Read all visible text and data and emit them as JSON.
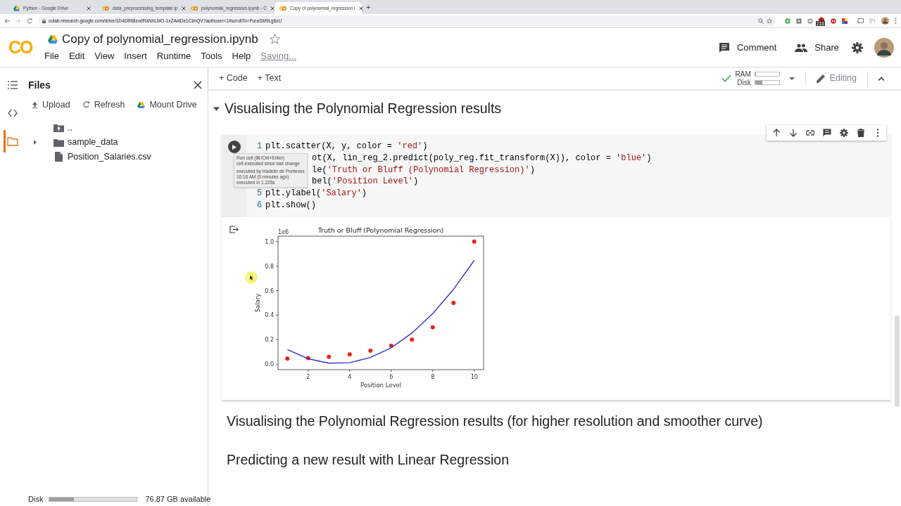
{
  "browser": {
    "tabs": [
      {
        "title": "Python - Google Drive",
        "selected": false
      },
      {
        "title": "data_preprocessing_template.ip",
        "selected": false
      },
      {
        "title": "polynomial_regression.ipynb - C",
        "selected": false
      },
      {
        "title": "Copy of polynomial_regression.i",
        "selected": true
      }
    ],
    "new_tab": "+",
    "url": "colab.research.google.com/drive/1D4DRl8izvdRaNhLMO-1xZAi4De1CimQV?authuser=1#scrollTo=PuraSM9Lg6zU",
    "extension_badge": "216"
  },
  "app": {
    "logo": "CO",
    "title": "Copy of polynomial_regression.ipynb",
    "starred": false,
    "menu": [
      "File",
      "Edit",
      "View",
      "Insert",
      "Runtime",
      "Tools",
      "Help"
    ],
    "save_status": "Saving...",
    "actions": [
      {
        "label": "Comment",
        "kind": "comment"
      },
      {
        "label": "Share",
        "kind": "share"
      }
    ]
  },
  "toolbar": {
    "insert": [
      "+ Code",
      "+ Text"
    ],
    "connected": true,
    "meters": [
      {
        "label": "RAM",
        "level": 0.04
      },
      {
        "label": "Disk",
        "level": 0.3
      }
    ],
    "mode": "Editing"
  },
  "sidebar": {
    "tabs": [
      {
        "kind": "toc",
        "selected": false
      },
      {
        "kind": "code",
        "selected": false
      },
      {
        "kind": "files",
        "selected": true
      }
    ],
    "title": "Files",
    "actions": [
      {
        "label": "Upload",
        "kind": "upload"
      },
      {
        "label": "Refresh",
        "kind": "refresh"
      },
      {
        "label": "Mount Drive",
        "kind": "drive"
      }
    ],
    "files": [
      {
        "name": "..",
        "kind": "parent"
      },
      {
        "name": "sample_data",
        "kind": "folder",
        "expanded": false
      },
      {
        "name": "Position_Salaries.csv",
        "kind": "file"
      }
    ],
    "disk": {
      "label": "Disk",
      "level": 0.28,
      "available": "76.87 GB available"
    }
  },
  "notebook": {
    "cells": [
      {
        "kind": "section",
        "text": "Visualising the Polynomial Regression results",
        "expanded": true
      },
      {
        "kind": "code",
        "lines": [
          {
            "number": "1",
            "tokens": [
              {
                "t": "plt.scatter(X, y, color = ",
                "kind": "code"
              },
              {
                "t": "'red'",
                "kind": "string"
              },
              {
                "t": ")",
                "kind": "code"
              }
            ]
          },
          {
            "tokens": [
              {
                "t": "ot(X, lin_reg_2.predict(poly_reg.fit_transform(X)), color = ",
                "kind": "code"
              },
              {
                "t": "'blue'",
                "kind": "string"
              },
              {
                "t": ")",
                "kind": "code"
              }
            ]
          },
          {
            "tokens": [
              {
                "t": "le(",
                "kind": "code"
              },
              {
                "t": "'Truth or Bluff (Polynomial Regression)'",
                "kind": "string"
              },
              {
                "t": ")",
                "kind": "code"
              }
            ]
          },
          {
            "tokens": [
              {
                "t": "bel(",
                "kind": "code"
              },
              {
                "t": "'Position Level'",
                "kind": "string"
              },
              {
                "t": ")",
                "kind": "code"
              }
            ]
          },
          {
            "number": "5",
            "tokens": [
              {
                "t": "plt.ylabel(",
                "kind": "code"
              },
              {
                "t": "'Salary'",
                "kind": "string"
              },
              {
                "t": ")",
                "kind": "code"
              }
            ]
          },
          {
            "number": "6",
            "tokens": [
              {
                "t": "plt.show()",
                "kind": "code"
              }
            ]
          }
        ],
        "tooltip": [
          [
            "Run cell (⌘/Ctrl+Enter)",
            "cell executed since last change"
          ],
          [
            "executed by Hadelin de Ponteves",
            "10:16 AM (0 minutes ago)",
            "executed in 1.225s"
          ]
        ],
        "output": {
          "chart_data": {
            "type": "line",
            "title": "Truth or Bluff (Polynomial Regression)",
            "xlabel": "Position Level",
            "ylabel": "Salary",
            "x": [
              1,
              2,
              3,
              4,
              5,
              6,
              7,
              8,
              9,
              10
            ],
            "series": [
              {
                "type": "scatter",
                "color": "#e8261c",
                "values": [
                  0.045,
                  0.05,
                  0.06,
                  0.08,
                  0.11,
                  0.15,
                  0.2,
                  0.3,
                  0.5,
                  1.0
                ]
              },
              {
                "type": "line",
                "color": "#3333cc",
                "values": [
                  0.119,
                  0.044,
                  0.008,
                  0.012,
                  0.054,
                  0.134,
                  0.254,
                  0.413,
                  0.61,
                  0.847
                ]
              }
            ],
            "xlim": [
              0.55,
              10.45
            ],
            "ylim": [
              -0.045,
              1.045
            ],
            "xticks": [
              2,
              4,
              6,
              8,
              10
            ],
            "yticks": [
              {
                "value": 0,
                "label": "0.0"
              },
              {
                "value": 0.2,
                "label": "0.2"
              },
              {
                "value": 0.4,
                "label": "0.4"
              },
              {
                "value": 0.6,
                "label": "0.6"
              },
              {
                "value": 0.8,
                "label": "0.8"
              },
              {
                "value": 1,
                "label": "1.0"
              }
            ],
            "annotations": [
              {
                "text": "1e6"
              }
            ]
          }
        }
      },
      {
        "kind": "text",
        "text": "Visualising the Polynomial Regression results (for higher resolution and smoother curve)"
      },
      {
        "kind": "text",
        "text": "Predicting a new result with Linear Regression"
      }
    ]
  }
}
